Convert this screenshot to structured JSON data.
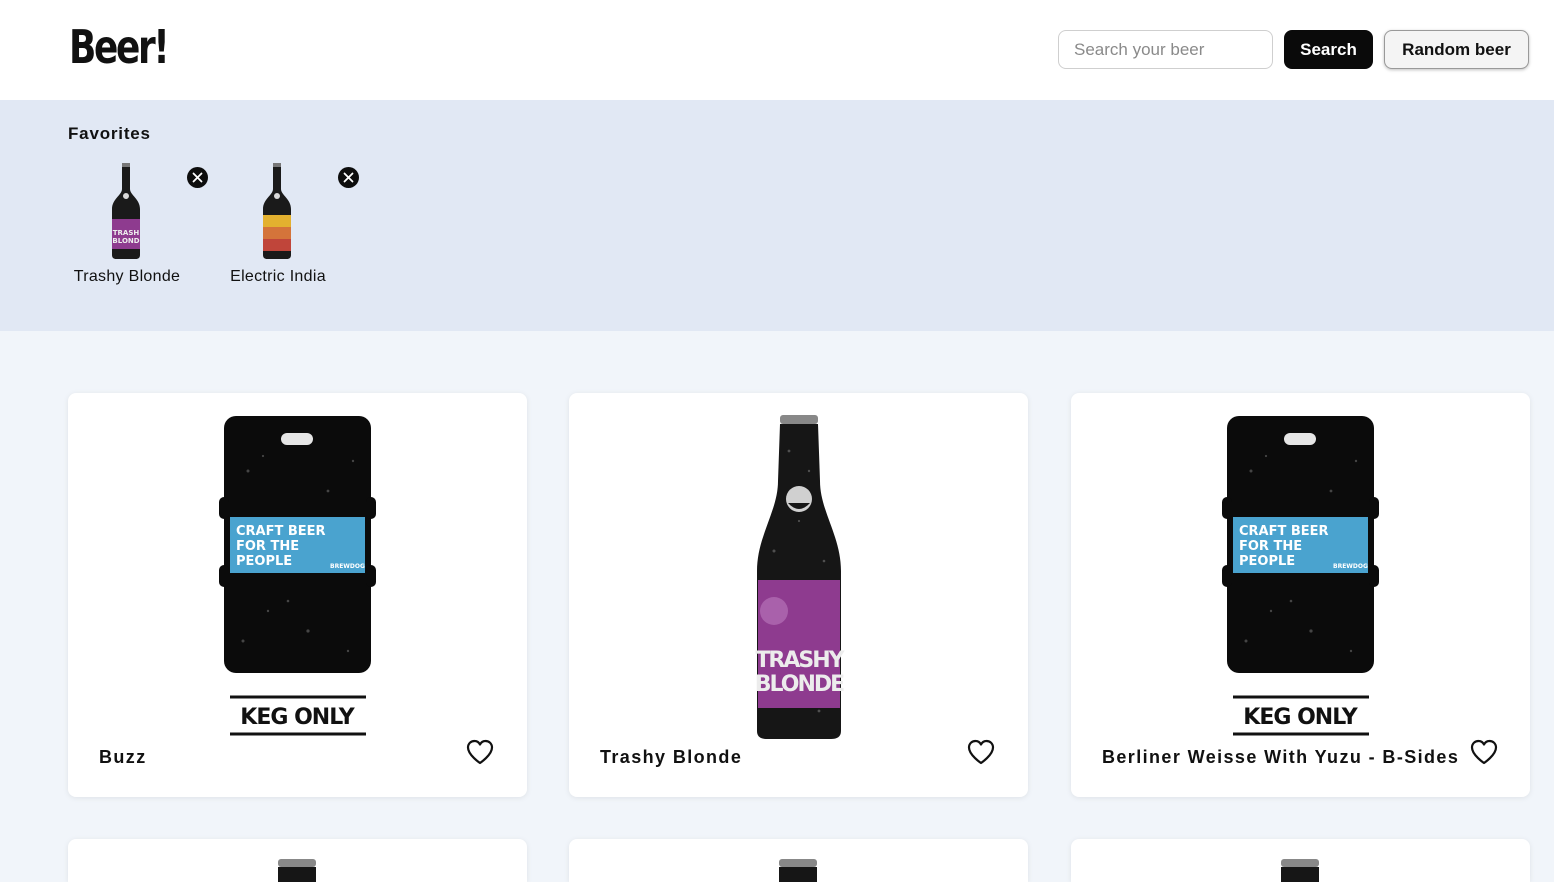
{
  "header": {
    "logo": "Beer!",
    "search_placeholder": "Search your beer",
    "search_label": "Search",
    "random_label": "Random beer"
  },
  "favorites": {
    "title": "Favorites",
    "items": [
      {
        "name": "Trashy Blonde",
        "label_color": "#8e3b8f"
      },
      {
        "name": "Electric India",
        "label_color": "#d4743a"
      }
    ]
  },
  "beers": [
    {
      "name": "Buzz",
      "type": "keg",
      "keg_label": "CRAFT BEER FOR THE PEOPLE",
      "keg_brand": "BREWDOG",
      "keg_note": "KEG ONLY"
    },
    {
      "name": "Trashy Blonde",
      "type": "bottle",
      "label_color": "#8e3b8f",
      "label_text": "TRASHY BLONDE"
    },
    {
      "name": "Berliner Weisse With Yuzu - B-Sides",
      "type": "keg",
      "keg_label": "CRAFT BEER FOR THE PEOPLE",
      "keg_brand": "BREWDOG",
      "keg_note": "KEG ONLY"
    }
  ],
  "colors": {
    "header_bg": "#ffffff",
    "favorites_bg": "#e1e8f4",
    "page_bg": "#f1f5fa",
    "keg_label_bg": "#4aa3cf",
    "primary_button": "#0a0a0a"
  }
}
